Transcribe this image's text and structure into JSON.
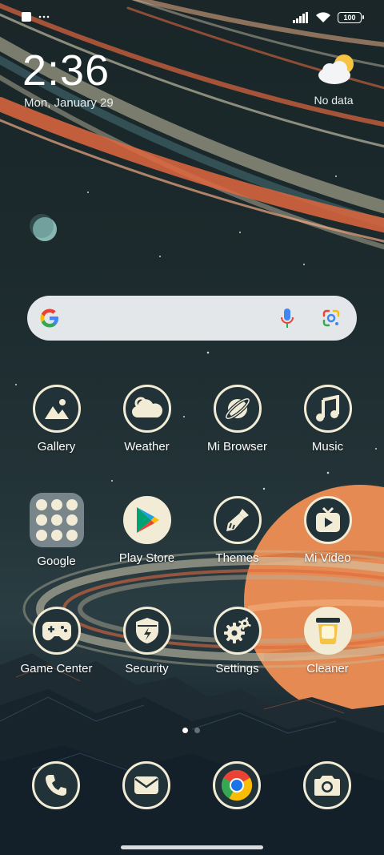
{
  "status_bar": {
    "battery": "100"
  },
  "clock": {
    "time": "2:36",
    "date": "Mon, January 29"
  },
  "weather_widget": {
    "text": "No data"
  },
  "search": {
    "placeholder": ""
  },
  "apps": [
    {
      "label": "Gallery",
      "icon": "gallery-icon"
    },
    {
      "label": "Weather",
      "icon": "weather-icon"
    },
    {
      "label": "Mi Browser",
      "icon": "browser-icon"
    },
    {
      "label": "Music",
      "icon": "music-icon"
    },
    {
      "label": "Google",
      "icon": "folder-icon"
    },
    {
      "label": "Play Store",
      "icon": "play-store-icon"
    },
    {
      "label": "Themes",
      "icon": "themes-brush-icon"
    },
    {
      "label": "Mi Video",
      "icon": "video-icon"
    },
    {
      "label": "Game Center",
      "icon": "gamepad-icon"
    },
    {
      "label": "Security",
      "icon": "shield-icon"
    },
    {
      "label": "Settings",
      "icon": "gear-icon"
    },
    {
      "label": "Cleaner",
      "icon": "trash-icon"
    }
  ],
  "dock": [
    {
      "icon": "phone-icon"
    },
    {
      "icon": "mail-icon"
    },
    {
      "icon": "chrome-icon"
    },
    {
      "icon": "camera-icon"
    }
  ],
  "pages": {
    "current": 1,
    "total": 2
  },
  "colors": {
    "icon_bg": "#213238",
    "icon_ring": "#f2ecd6",
    "ring_orange": "#e0673f",
    "planet_orange": "#e58a52"
  }
}
